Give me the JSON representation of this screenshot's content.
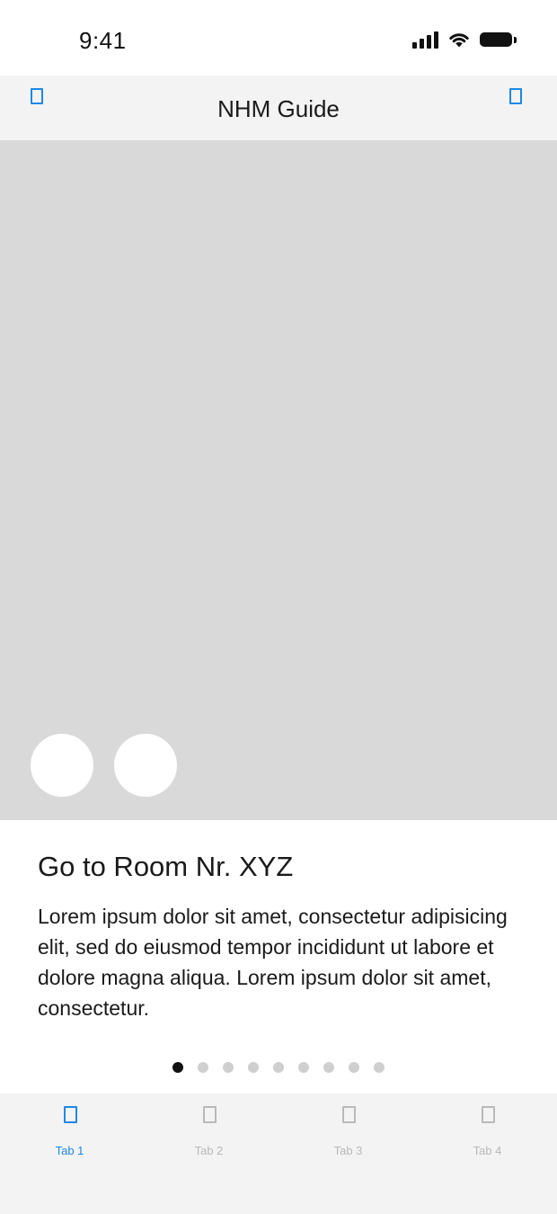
{
  "status_bar": {
    "time": "9:41",
    "icons": [
      "signal-icon",
      "wifi-icon",
      "battery-icon"
    ]
  },
  "nav": {
    "title": "NHM Guide",
    "left_icon": "placeholder-icon",
    "right_icon": "placeholder-icon",
    "accent_color": "#1e88e5"
  },
  "hero": {
    "background_color": "#d9d9d9",
    "buttons": [
      "circle-button",
      "circle-button"
    ]
  },
  "content": {
    "title": "Go to Room Nr. XYZ",
    "body": "Lorem ipsum dolor sit amet, consectetur adipisicing elit, sed do eiusmod tempor incididunt ut labore et dolore magna aliqua. Lorem ipsum dolor sit amet, consectetur."
  },
  "pagination": {
    "count": 9,
    "active_index": 0
  },
  "tabs": [
    {
      "label": "Tab 1",
      "icon": "placeholder-icon",
      "active": true
    },
    {
      "label": "Tab 2",
      "icon": "placeholder-icon",
      "active": false
    },
    {
      "label": "Tab 3",
      "icon": "placeholder-icon",
      "active": false
    },
    {
      "label": "Tab 4",
      "icon": "placeholder-icon",
      "active": false
    }
  ]
}
